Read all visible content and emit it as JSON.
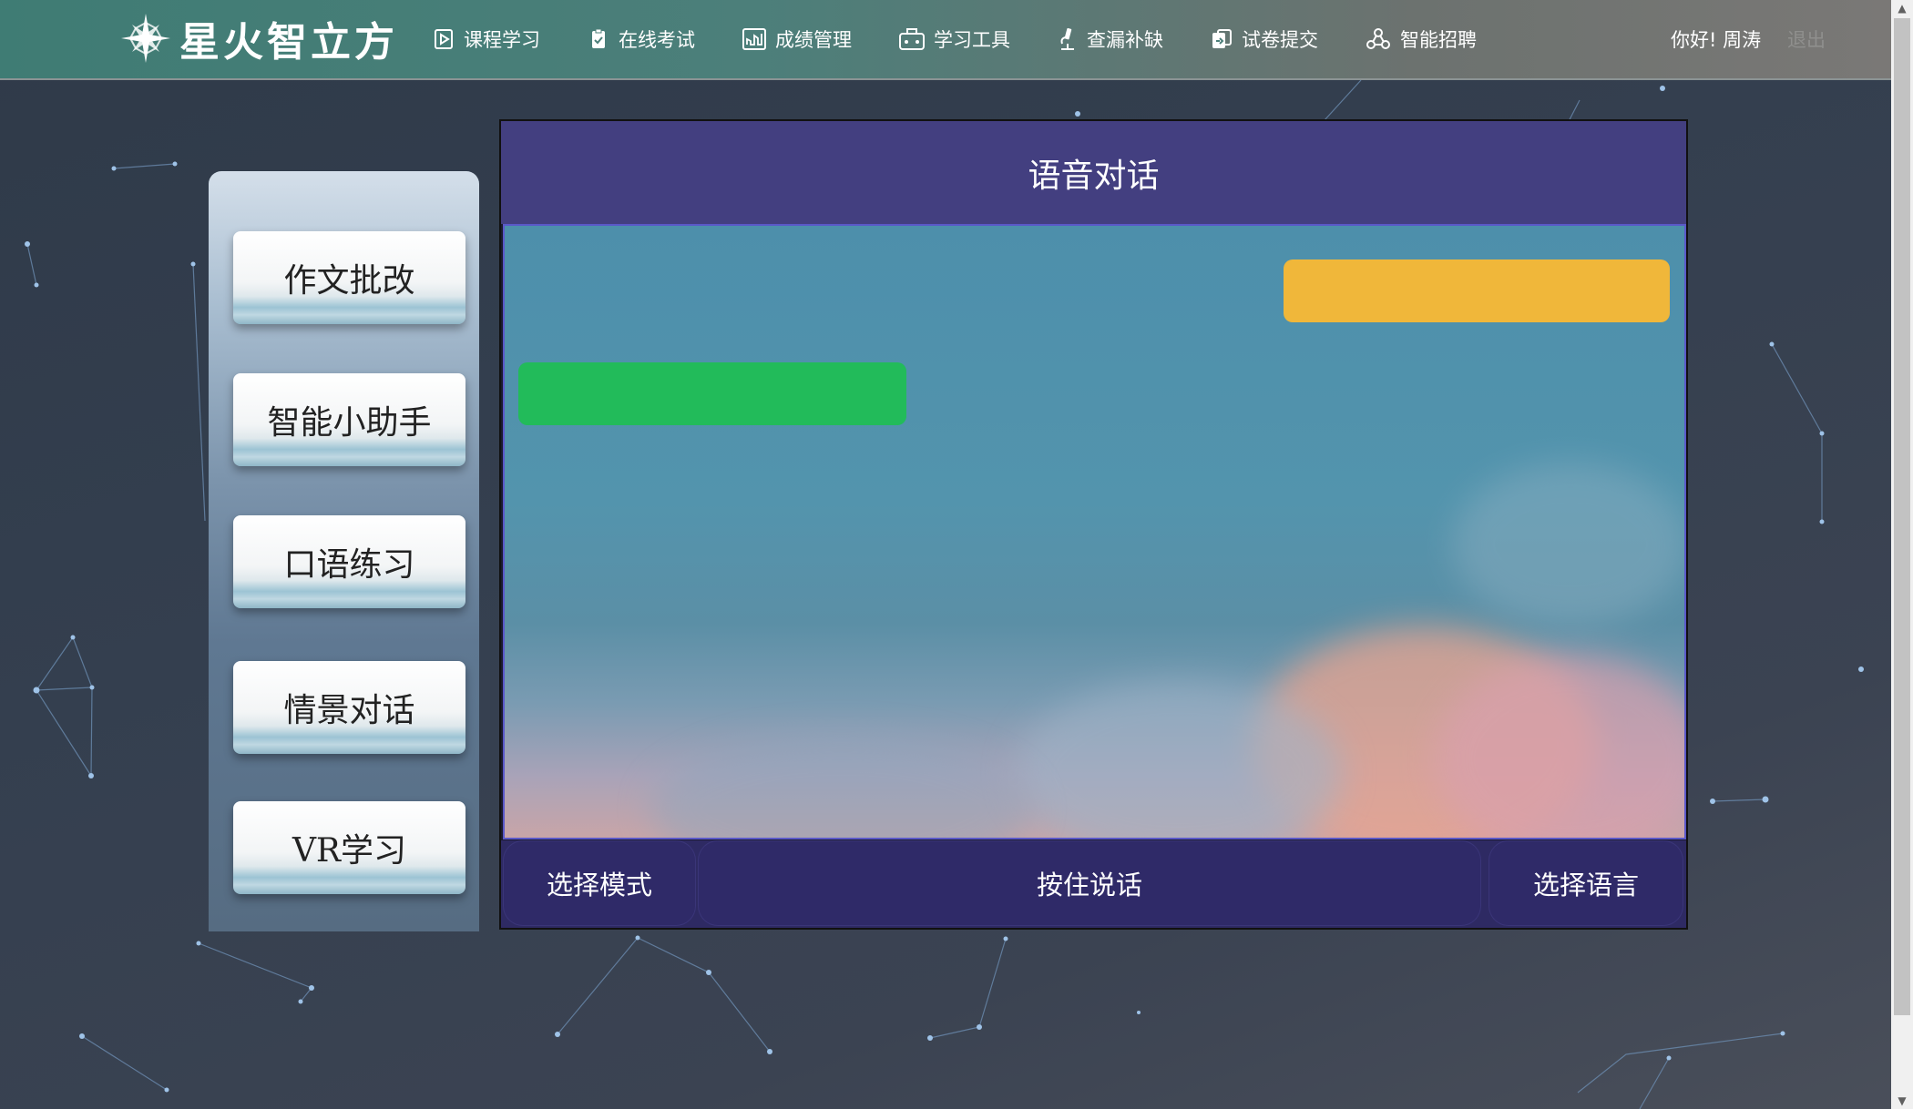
{
  "app": {
    "brand": "星火智立方",
    "greeting": "你好! 周涛",
    "logout_label": "退出"
  },
  "nav": {
    "items": [
      {
        "label": "课程学习",
        "icon": "play-square-icon"
      },
      {
        "label": "在线考试",
        "icon": "clipboard-check-icon"
      },
      {
        "label": "成绩管理",
        "icon": "chart-icon"
      },
      {
        "label": "学习工具",
        "icon": "toolbox-icon"
      },
      {
        "label": "查漏补缺",
        "icon": "microscope-icon"
      },
      {
        "label": "试卷提交",
        "icon": "submit-icon"
      },
      {
        "label": "智能招聘",
        "icon": "network-icon"
      }
    ]
  },
  "sidebar": {
    "items": [
      {
        "label": "作文批改"
      },
      {
        "label": "智能小助手"
      },
      {
        "label": "口语练习"
      },
      {
        "label": "情景对话"
      },
      {
        "label": "VR学习"
      }
    ]
  },
  "panel": {
    "title": "语音对话",
    "mode_button": "选择模式",
    "talk_button": "按住说话",
    "language_button": "选择语言"
  },
  "colors": {
    "topbar_start": "#3f7c74",
    "panel_header": "#433f80",
    "bubble_user": "#f0b73a",
    "bubble_bot": "#22bb5a",
    "bottom_bar": "#2e2a63"
  }
}
